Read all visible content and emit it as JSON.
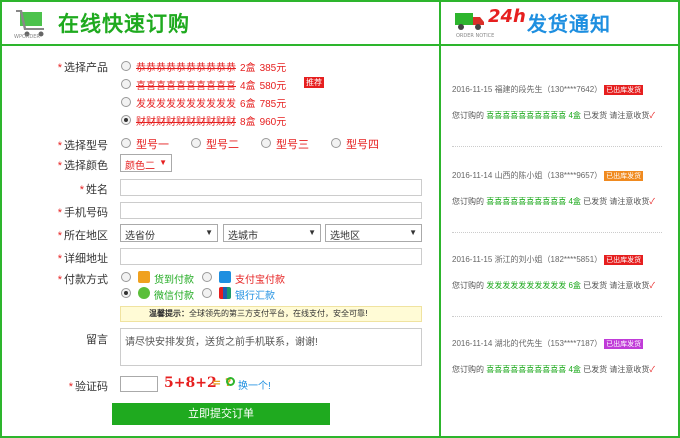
{
  "header": {
    "title": "在线快速订购",
    "logo_text": "WPORDER",
    "notice_title": "发货通知",
    "notice_badge": "24h",
    "notice_sub": "ORDER NOTICE"
  },
  "form": {
    "product_label": "选择产品",
    "products": [
      {
        "name": "恭恭恭恭恭恭恭恭恭恭",
        "qty": "2盒",
        "price": "385元",
        "checked": false,
        "strike": true
      },
      {
        "name": "喜喜喜喜喜喜喜喜喜喜",
        "qty": "4盒",
        "price": "580元",
        "checked": false,
        "strike": true,
        "badge": "推荐"
      },
      {
        "name": "发发发发发发发发发发",
        "qty": "6盒",
        "price": "785元",
        "checked": false,
        "strike": false
      },
      {
        "name": "财财财财财财财财财财",
        "qty": "8盒",
        "price": "960元",
        "checked": true,
        "strike": true
      }
    ],
    "model_label": "选择型号",
    "models": [
      "型号一",
      "型号二",
      "型号三",
      "型号四"
    ],
    "color_label": "选择颜色",
    "color_value": "颜色二",
    "name_label": "姓名",
    "phone_label": "手机号码",
    "region_label": "所在地区",
    "province": "选省份",
    "city": "选城市",
    "district": "选地区",
    "address_label": "详细地址",
    "pay_label": "付款方式",
    "pay_options": [
      "货到付款",
      "支付宝付款",
      "微信付款",
      "银行汇款"
    ],
    "tip_title": "温馨提示：",
    "tip_text": "全球领先的第三方支付平台，在线支付，安全可靠!",
    "message_label": "留言",
    "message_value": "请尽快安排发货，送货之前手机联系，谢谢!",
    "captcha_label": "验证码",
    "captcha_text": "5+8+2",
    "captcha_eq": "= ?",
    "captcha_swap": "换一个!",
    "submit_label": "立即提交订单"
  },
  "notices": [
    {
      "date": "2016-11-15",
      "who": "福建的段先生",
      "phone": "（130****7642）",
      "status": "已出库发货",
      "status_color": "#e61f1f",
      "product": "喜喜喜喜喜喜喜喜喜喜",
      "qty": "4盒",
      "tail": "已发货 请注意收货"
    },
    {
      "date": "2016-11-14",
      "who": "山西的陈小姐",
      "phone": "（138****9657）",
      "status": "已出库发货",
      "status_color": "#f08a1f",
      "product": "喜喜喜喜喜喜喜喜喜喜",
      "qty": "4盒",
      "tail": "已发货 请注意收货"
    },
    {
      "date": "2016-11-15",
      "who": "浙江的刘小姐",
      "phone": "（182****5851）",
      "status": "已出库发货",
      "status_color": "#e61f1f",
      "product": "发发发发发发发发发发",
      "qty": "6盒",
      "tail": "已发货 请注意收货"
    },
    {
      "date": "2016-11-14",
      "who": "湖北的代先生",
      "phone": "（153****7187）",
      "status": "已出库发货",
      "status_color": "#c03bd8",
      "product": "喜喜喜喜喜喜喜喜喜喜",
      "qty": "4盒",
      "tail": "已发货 请注意收货"
    }
  ],
  "notice_prefix": "您订购的"
}
